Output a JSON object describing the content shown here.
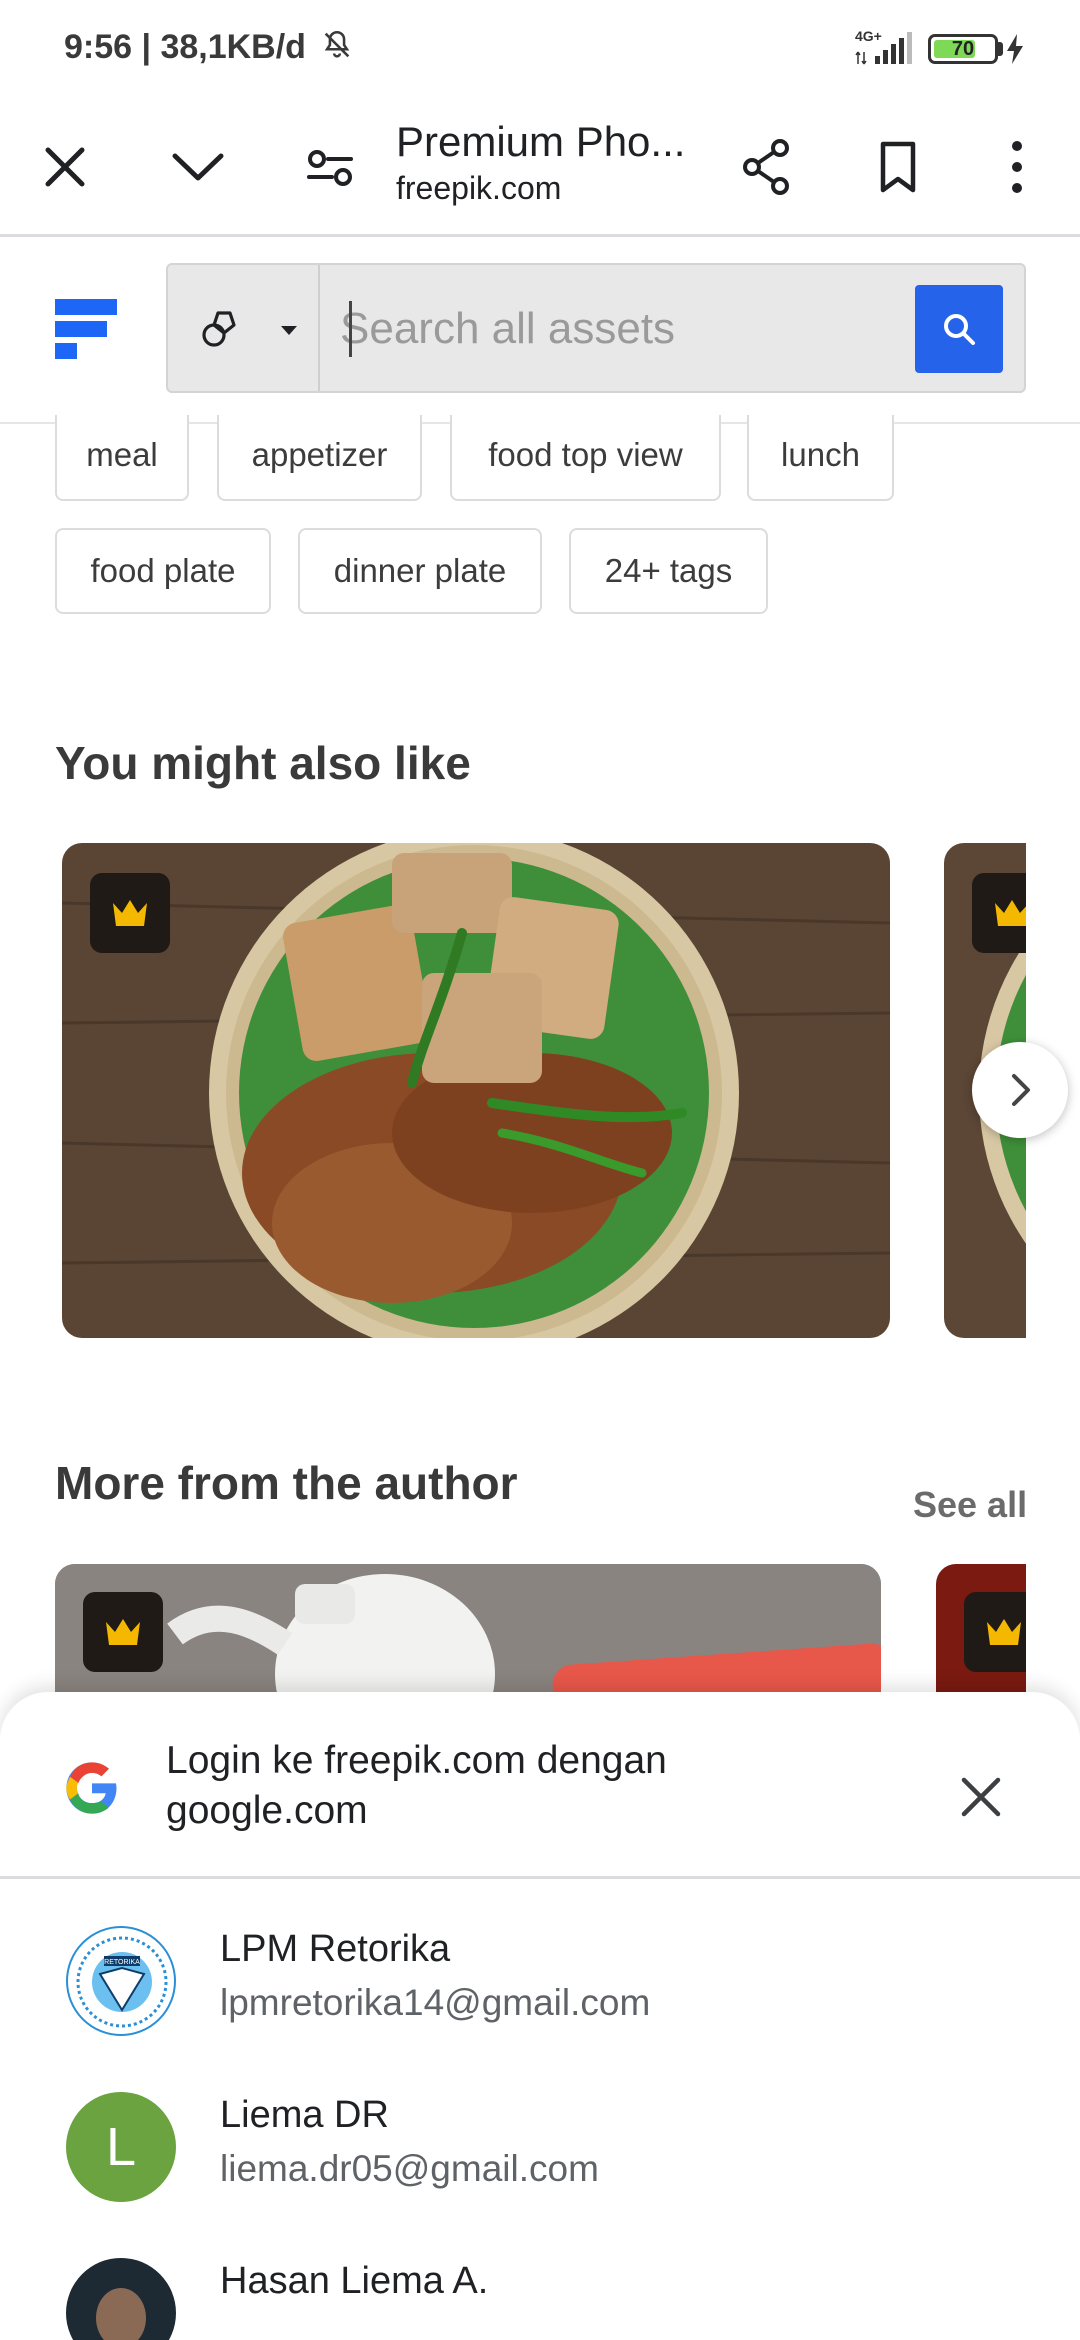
{
  "status_bar": {
    "time": "9:56 | 38,1KB/d",
    "network": "4G+",
    "battery": "70",
    "battery_level": 0.7
  },
  "toolbar": {
    "title": "Premium Pho...",
    "url": "freepik.com"
  },
  "search": {
    "placeholder": "Search all assets"
  },
  "tags": [
    "meal",
    "appetizer",
    "food top view",
    "lunch",
    "food plate",
    "dinner plate",
    "24+ tags"
  ],
  "sections": {
    "also_like_title": "You might also like",
    "author_title": "More from the author",
    "see_all": "See all"
  },
  "login_sheet": {
    "title": "Login ke freepik.com dengan google.com",
    "accounts": [
      {
        "name": "LPM Retorika",
        "email": "lpmretorika14@gmail.com",
        "avatar_text": "RETORIKA"
      },
      {
        "name": "Liema DR",
        "email": "liema.dr05@gmail.com",
        "avatar_letter": "L",
        "avatar_color": "#6aa33f"
      },
      {
        "name": "Hasan Liema A."
      }
    ]
  },
  "colors": {
    "search_button": "#2563eb",
    "crown": "#f5b800",
    "freepik_logo": "#1e66f5"
  }
}
